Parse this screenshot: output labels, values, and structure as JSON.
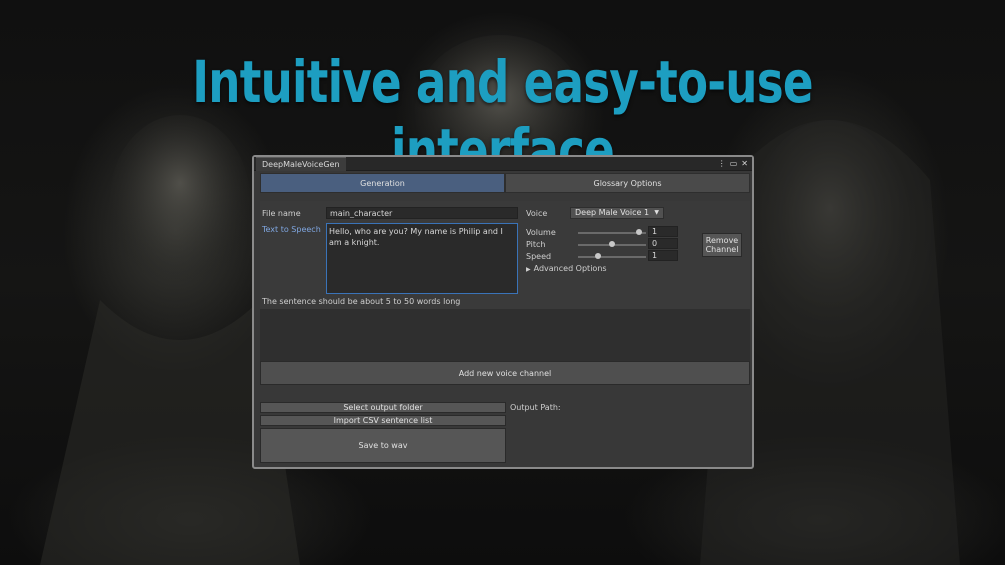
{
  "headline": "Intuitive and easy-to-use interface",
  "window": {
    "title": "DeepMaleVoiceGen",
    "icons": [
      "more-vertical-icon",
      "maximize-icon",
      "close-icon"
    ]
  },
  "tabs": [
    {
      "label": "Generation",
      "active": true
    },
    {
      "label": "Glossary Options",
      "active": false
    }
  ],
  "channel": {
    "file_name_label": "File name",
    "file_name_value": "main_character",
    "tts_label": "Text to Speech",
    "tts_value": "Hello, who are you? My name is Philip and I am a knight.",
    "hint": "The sentence should be about 5 to 50 words long",
    "voice_label": "Voice",
    "voice_value": "Deep Male Voice 1",
    "volume_label": "Volume",
    "volume_value": "1",
    "volume_level": 0.9,
    "pitch_label": "Pitch",
    "pitch_value": "0",
    "pitch_level": 0.5,
    "speed_label": "Speed",
    "speed_value": "1",
    "speed_level": 0.3,
    "advanced_label": "Advanced Options",
    "remove_label_line1": "Remove",
    "remove_label_line2": "Channel"
  },
  "add_channel_label": "Add new voice channel",
  "output": {
    "select_folder_label": "Select output folder",
    "import_csv_label": "Import CSV sentence list",
    "save_label": "Save to wav",
    "output_path_label": "Output Path:"
  },
  "colors": {
    "headline": "#1d9ec1",
    "active_tab": "#4a5f7f",
    "tts_label": "#7fa6e0"
  }
}
